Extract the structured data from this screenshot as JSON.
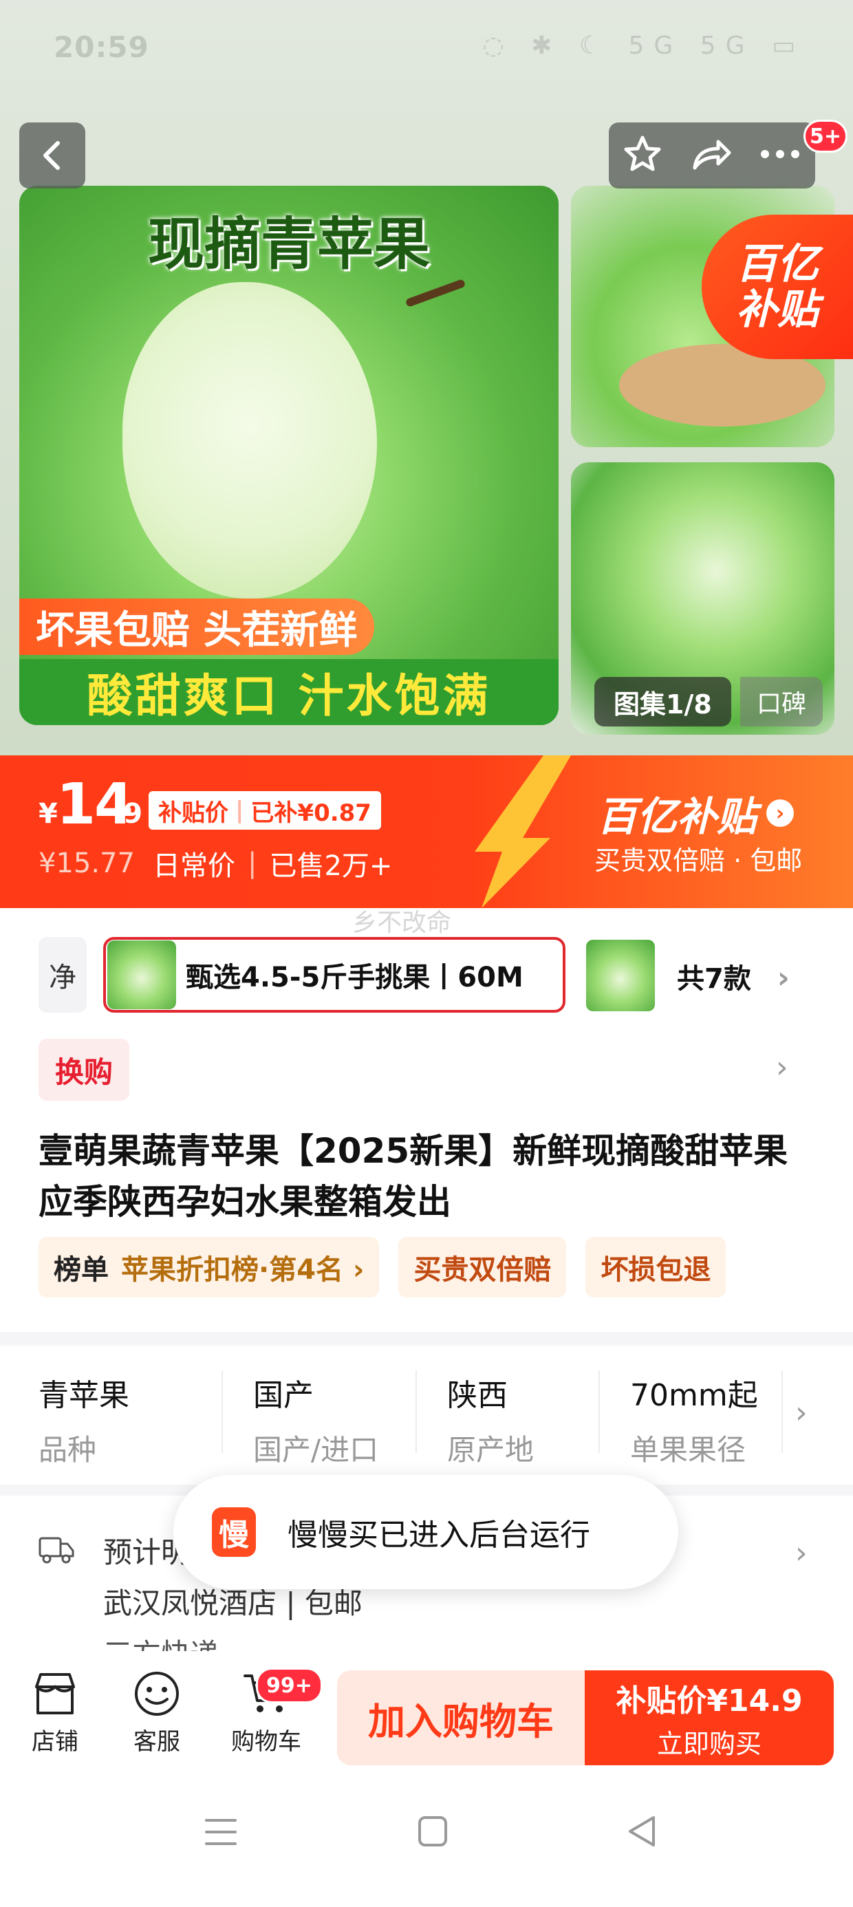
{
  "status_bar": {
    "time": "20:59",
    "icons": "◌ ✱ ☾ 5G 5G ▭"
  },
  "gallery": {
    "top_badge": "5+",
    "main_title": "现摘青苹果",
    "main_tag_orange": "坏果包赔 头茬新鲜",
    "main_tag_green": "酸甜爽口 汁水饱满",
    "subsidy_tag_line1": "百亿",
    "subsidy_tag_line2": "补贴",
    "gallery_count": "图集1/8",
    "word_of_mouth": "口碑"
  },
  "price": {
    "currency": "¥",
    "integer": "14",
    "decimal": ".9",
    "chip_label": "补贴价",
    "chip_subsidy": "已补¥0.87",
    "original": "¥15.77",
    "daily_label": "日常价",
    "sold": "已售2万+",
    "banner_title": "百亿补贴",
    "banner_sub": "买贵双倍赔 · 包邮"
  },
  "watermark": "乡不改命",
  "sku": {
    "prev_partial": "净",
    "selected_label": "甄选4.5-5斤手挑果丨60M",
    "total": "共7款"
  },
  "swap_tag": "换购",
  "product_title": "壹萌果蔬青苹果【2025新果】新鲜现摘酸甜苹果应季陕西孕妇水果整箱发出",
  "badges": {
    "rank_key": "榜单",
    "rank_value": "苹果折扣榜·第4名 ›",
    "double": "买贵双倍赔",
    "damage": "坏损包退"
  },
  "specs": [
    {
      "value": "青苹果",
      "key": "品种"
    },
    {
      "value": "国产",
      "key": "国产/进口"
    },
    {
      "value": "陕西",
      "key": "原产地"
    },
    {
      "value": "70mm起",
      "key": "单果果径"
    }
  ],
  "delivery": {
    "line1": "预计明",
    "line2": "武汉凤悦酒店 | 包邮",
    "line3": "三方快递"
  },
  "toast": {
    "icon_text": "慢",
    "message": "慢慢买已进入后台运行"
  },
  "bottom": {
    "store": "店铺",
    "service": "客服",
    "cart": "购物车",
    "cart_badge": "99+",
    "add_cart": "加入购物车",
    "buy_top": "补贴价¥14.9",
    "buy_sub": "立即购买"
  },
  "colors": {
    "accent_red": "#ff3a17",
    "badge_red": "#ff2d3d",
    "selected_border": "#e0262e",
    "apple_green": "#5fb845"
  }
}
